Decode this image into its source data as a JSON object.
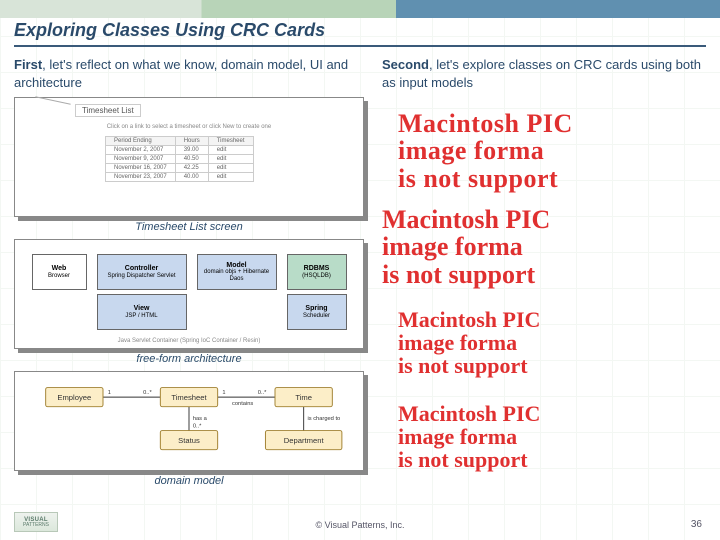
{
  "title": "Exploring Classes Using CRC Cards",
  "left": {
    "lead_bold": "First",
    "lead_rest": ", let's reflect on what we know, domain model, UI and architecture"
  },
  "right": {
    "lead_bold": "Second",
    "lead_rest": ", let's explore classes on CRC cards using both as input models"
  },
  "timesheet": {
    "title": "Timesheet List",
    "subtitle": "Click on a link to select a timesheet or click New to create one",
    "headers": [
      "Period Ending",
      "Hours",
      "Timesheet"
    ],
    "rows": [
      [
        "November 2, 2007",
        "39.00",
        "edit"
      ],
      [
        "November 9, 2007",
        "40.50",
        "edit"
      ],
      [
        "November 16, 2007",
        "42.25",
        "edit"
      ],
      [
        "November 23, 2007",
        "40.00",
        "edit"
      ]
    ],
    "caption": "Timesheet List screen"
  },
  "architecture": {
    "boxes": {
      "browser": {
        "title": "Web",
        "sub": "Browser"
      },
      "controller": {
        "title": "Controller",
        "sub": "Spring\nDispatcher Servlet"
      },
      "model": {
        "title": "Model",
        "sub": "domain objs +\nHibernate\nDaos"
      },
      "rdbms": {
        "title": "RDBMS",
        "sub": "(HSQLDB)"
      },
      "view": {
        "title": "View",
        "sub": "JSP / HTML"
      },
      "scheduler": {
        "title": "Spring",
        "sub": "Scheduler"
      }
    },
    "footer": "Java Servlet Container (Spring IoC Container / Resin)",
    "caption": "free-form architecture"
  },
  "domain": {
    "entities": {
      "employee": "Employee",
      "timesheet": "Timesheet",
      "time": "Time",
      "status": "Status",
      "department": "Department"
    },
    "assoc": {
      "emp_ts_left": "1",
      "emp_ts_right": "0..*",
      "ts_time_left": "1",
      "ts_time_right": "0..*",
      "ts_status": "has a",
      "ts_status_mult": "0..*",
      "time_dept": "is charged to",
      "contains": "contains"
    },
    "caption": "domain model"
  },
  "pict_error": {
    "l1": "Macintosh PIC",
    "l2": "image forma",
    "l3": "is not support"
  },
  "footer": "© Visual Patterns, Inc.",
  "page": "36",
  "logo": {
    "l1": "VISUAL",
    "l2": "PATTERNS"
  }
}
